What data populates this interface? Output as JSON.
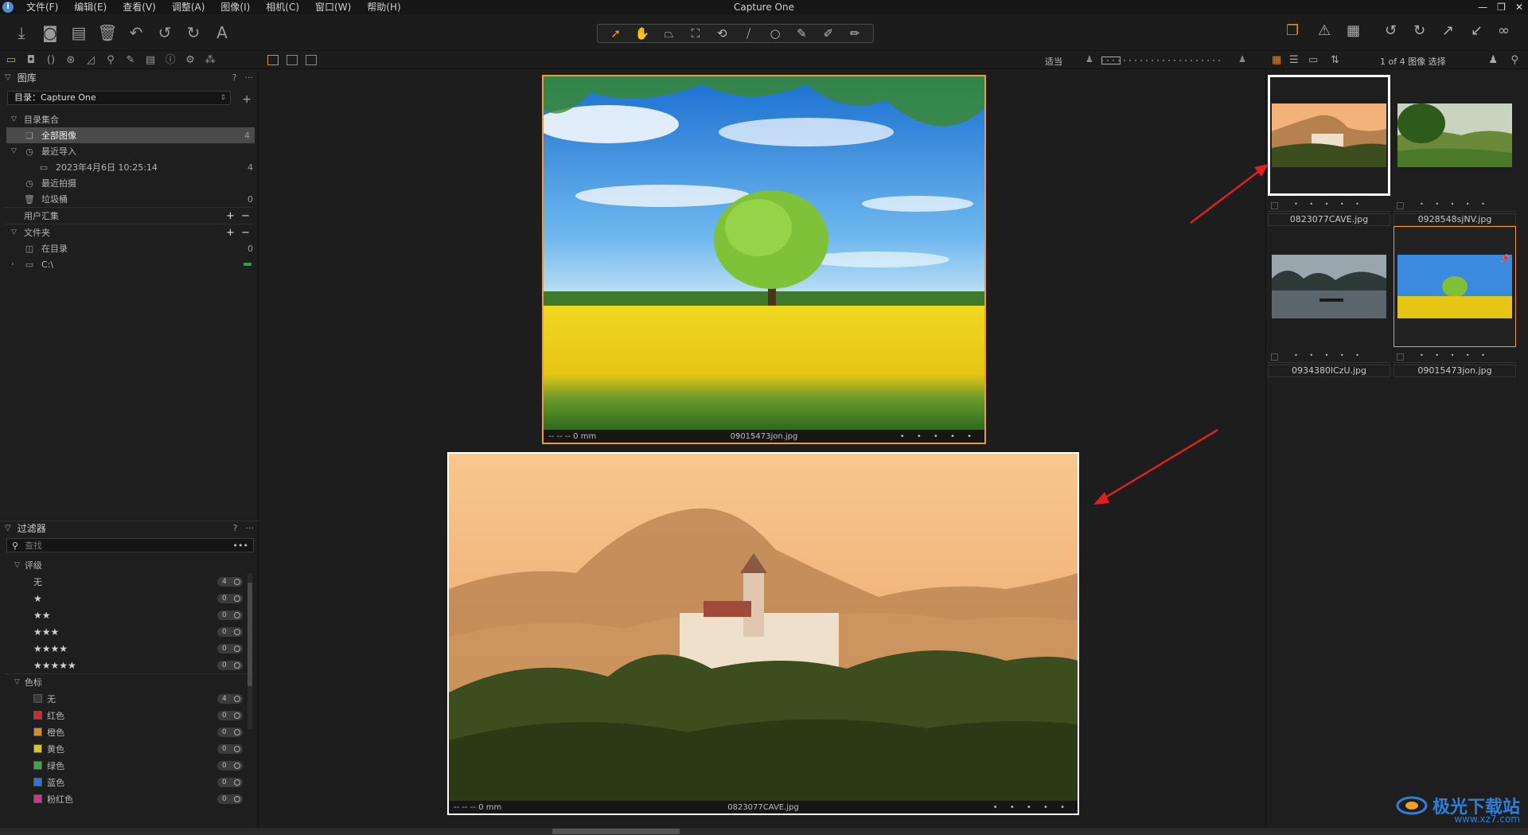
{
  "app": {
    "title": "Capture One",
    "menu": [
      "文件(F)",
      "编辑(E)",
      "查看(V)",
      "调整(A)",
      "图像(I)",
      "相机(C)",
      "窗口(W)",
      "帮助(H)"
    ],
    "window_controls": [
      "—",
      "❐",
      "✕"
    ]
  },
  "library": {
    "header": "图库",
    "catalog_label": "目录：Capture One",
    "collections_header": "目录集合",
    "all_images": {
      "label": "全部图像",
      "count": "4"
    },
    "recent_imports": {
      "label": "最近导入",
      "count": ""
    },
    "import_date": {
      "label": "2023年4月6日 10:25:14",
      "count": "4"
    },
    "recent_captures": {
      "label": "最近拍摄",
      "count": ""
    },
    "trash": {
      "label": "垃圾桶",
      "count": "0"
    },
    "user_collections": "用户汇集",
    "folders_header": "文件夹",
    "in_catalog": {
      "label": "在目录",
      "count": "0"
    },
    "drive": {
      "label": "C:\\"
    }
  },
  "filters": {
    "header": "过滤器",
    "search_placeholder": "查找",
    "rating_header": "评级",
    "ratings": [
      {
        "label": "无",
        "stars": "",
        "count": "4"
      },
      {
        "label": "",
        "stars": "★",
        "count": "0"
      },
      {
        "label": "",
        "stars": "★★",
        "count": "0"
      },
      {
        "label": "",
        "stars": "★★★",
        "count": "0"
      },
      {
        "label": "",
        "stars": "★★★★",
        "count": "0"
      },
      {
        "label": "",
        "stars": "★★★★★",
        "count": "0"
      }
    ],
    "color_header": "色标",
    "colors": [
      {
        "label": "无",
        "color": "#3a3a3a",
        "count": "4"
      },
      {
        "label": "红色",
        "color": "#d02a2a",
        "count": "0"
      },
      {
        "label": "橙色",
        "color": "#e08a1c",
        "count": "0"
      },
      {
        "label": "黄色",
        "color": "#d8c81c",
        "count": "0"
      },
      {
        "label": "绿色",
        "color": "#2fae3c",
        "count": "0"
      },
      {
        "label": "蓝色",
        "color": "#2a78d6",
        "count": "0"
      },
      {
        "label": "粉红色",
        "color": "#d8308a",
        "count": "0"
      }
    ]
  },
  "viewer": {
    "zoom_label": "适当",
    "image_top": {
      "meta": "-- -- -- 0 mm",
      "filename": "09015473jon.jpg",
      "rating": "• • • • •"
    },
    "image_bottom": {
      "meta": "-- -- -- 0 mm",
      "filename": "0823077CAVE.jpg",
      "rating": "• • • • •"
    }
  },
  "browser": {
    "count_label": "1 of 4 图像 选择",
    "thumbnails": [
      {
        "filename": "0823077CAVE.jpg",
        "rating": "• • • • •"
      },
      {
        "filename": "0928548sjNV.jpg",
        "rating": "• • • • •"
      },
      {
        "filename": "0934380lCzU.jpg",
        "rating": "• • • • •"
      },
      {
        "filename": "09015473jon.jpg",
        "rating": "• • • • •"
      }
    ]
  },
  "watermark": {
    "text": "极光下载站",
    "url": "www.xz7.com"
  },
  "colors": {
    "accent": "#f29a2e",
    "background": "#1e1e1e",
    "arrow": "#e02020"
  }
}
